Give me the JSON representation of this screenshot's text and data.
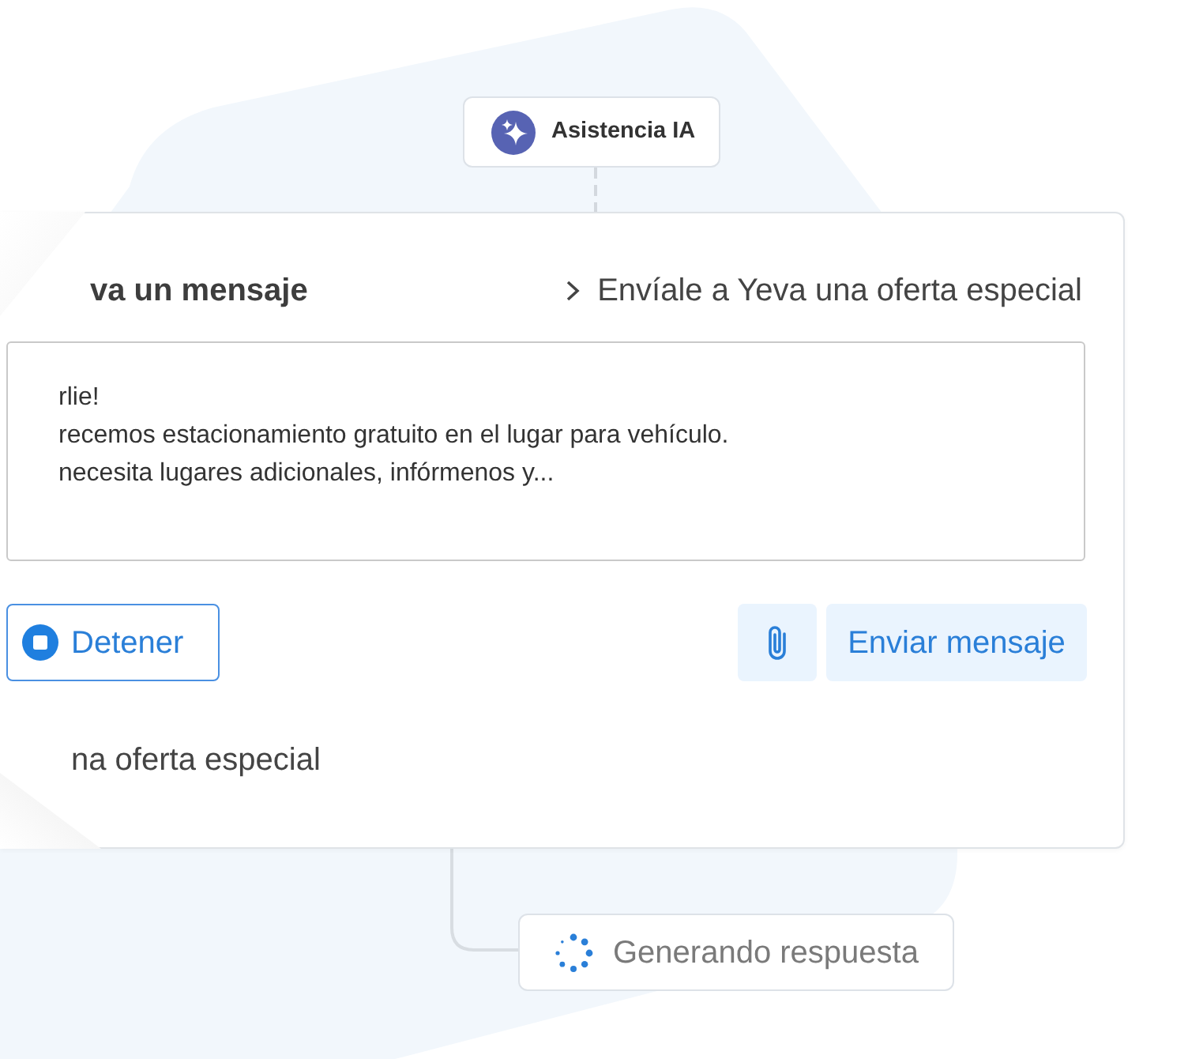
{
  "assistant_node": {
    "label": "Asistencia IA"
  },
  "card": {
    "title": "va un mensaje",
    "suggestion": "Envíale a Yeva una oferta especial",
    "message_lines": [
      "rlie!",
      "recemos estacionamiento gratuito en el lugar para vehículo.",
      "necesita lugares adicionales, infórmenos y..."
    ],
    "stop_button": {
      "label": "Detener"
    },
    "send_button": {
      "label": "Enviar mensaje"
    },
    "prompt": "na oferta especial"
  },
  "status_node": {
    "label": "Generando respuesta"
  }
}
